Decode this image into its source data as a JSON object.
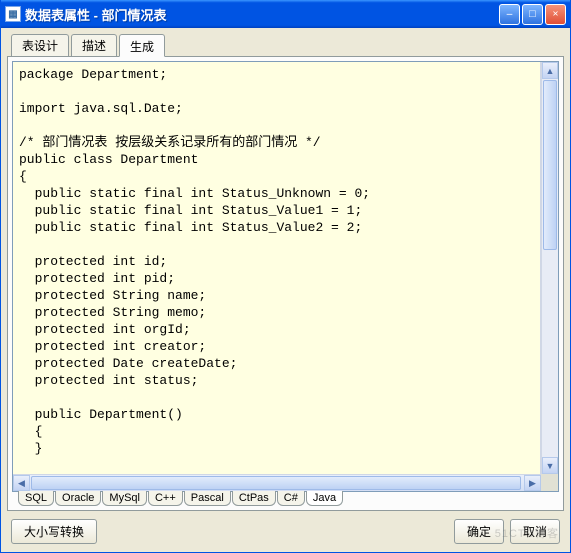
{
  "window": {
    "title": "数据表属性 - 部门情况表"
  },
  "topTabs": {
    "items": [
      "表设计",
      "描述",
      "生成"
    ],
    "activeIndex": 2
  },
  "code": "package Department;\n\nimport java.sql.Date;\n\n/* 部门情况表 按层级关系记录所有的部门情况 */\npublic class Department\n{\n  public static final int Status_Unknown = 0;\n  public static final int Status_Value1 = 1;\n  public static final int Status_Value2 = 2;\n\n  protected int id;\n  protected int pid;\n  protected String name;\n  protected String memo;\n  protected int orgId;\n  protected int creator;\n  protected Date createDate;\n  protected int status;\n\n  public Department()\n  {\n  }",
  "bottomTabs": {
    "items": [
      "SQL",
      "Oracle",
      "MySql",
      "C++",
      "Pascal",
      "CtPas",
      "C#",
      "Java"
    ],
    "activeIndex": 7
  },
  "buttons": {
    "caseToggle": "大小写转换",
    "ok": "确定",
    "cancel": "取消"
  },
  "watermark": "51CTO博客"
}
